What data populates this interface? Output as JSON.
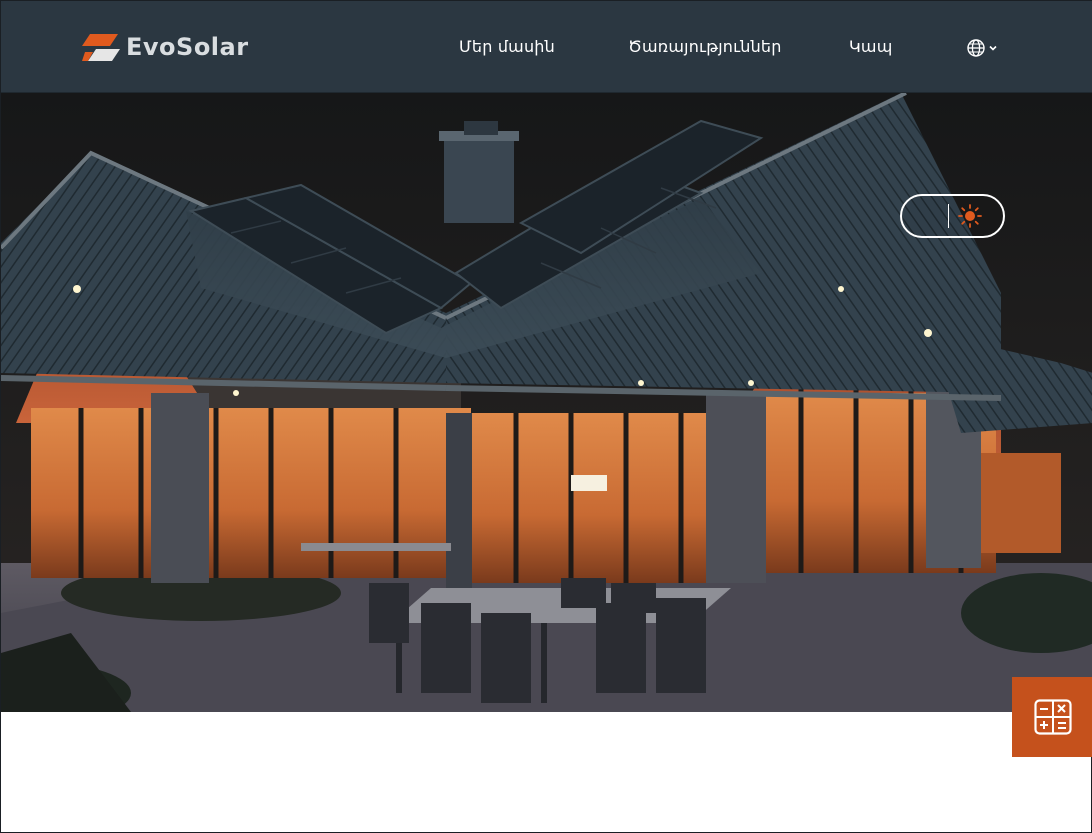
{
  "brand": {
    "name": "EvoSolar",
    "accent_color": "#e05a1e",
    "header_bg": "#2b3741"
  },
  "nav": {
    "items": [
      {
        "label": "Մեր մասին"
      },
      {
        "label": "Ծառայություններ"
      },
      {
        "label": "Կապ"
      }
    ],
    "language_icon": "globe-icon",
    "language_chevron_icon": "chevron-down-icon"
  },
  "hero": {
    "image_subject": "modern house with solar roof panels at dusk, lit interior, patio with dining table",
    "theme_toggle": {
      "dark_icon": "moon-icon",
      "light_icon": "sun-icon",
      "active": "light"
    }
  },
  "floating_action": {
    "icon": "calculator-icon",
    "color": "#c5511c"
  }
}
